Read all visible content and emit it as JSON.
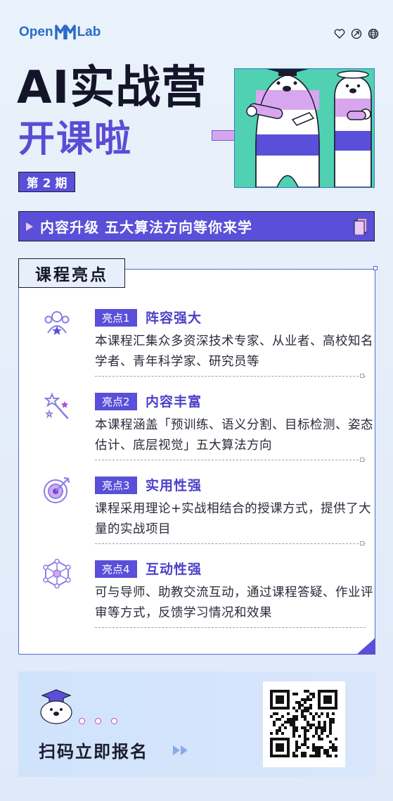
{
  "header": {
    "logo_left": "Open",
    "logo_right": "Lab",
    "title_line1": "AI实战营",
    "title_line2": "开课啦",
    "period_label": "第 2 期",
    "icons": [
      "heart-icon",
      "share-icon",
      "globe-icon"
    ]
  },
  "banner": {
    "text": "内容升级  五大算法方向等你来学"
  },
  "highlights": {
    "section_title": "课程亮点",
    "items": [
      {
        "badge": "亮点1",
        "heading": "阵容强大",
        "desc": "本课程汇集众多资深技术专家、从业者、高校知名学者、青年科学家、研究员等",
        "icon": "team-icon"
      },
      {
        "badge": "亮点2",
        "heading": "内容丰富",
        "desc": "本课程涵盖「预训练、语义分割、目标检测、姿态估计、底层视觉」五大算法方向",
        "icon": "magic-wand-icon"
      },
      {
        "badge": "亮点3",
        "heading": "实用性强",
        "desc": "课程采用理论+实战相结合的授课方式，提供了大量的实战项目",
        "icon": "target-icon"
      },
      {
        "badge": "亮点4",
        "heading": "互动性强",
        "desc": "可与导师、助教交流互动，通过课程答疑、作业评审等方式，反馈学习情况和效果",
        "icon": "network-icon"
      }
    ]
  },
  "signup": {
    "text": "扫码立即报名"
  },
  "colors": {
    "accent": "#5a4fd8",
    "mint": "#4fd1b2",
    "lilac": "#d8a6ee",
    "background": "#e6eefa"
  }
}
